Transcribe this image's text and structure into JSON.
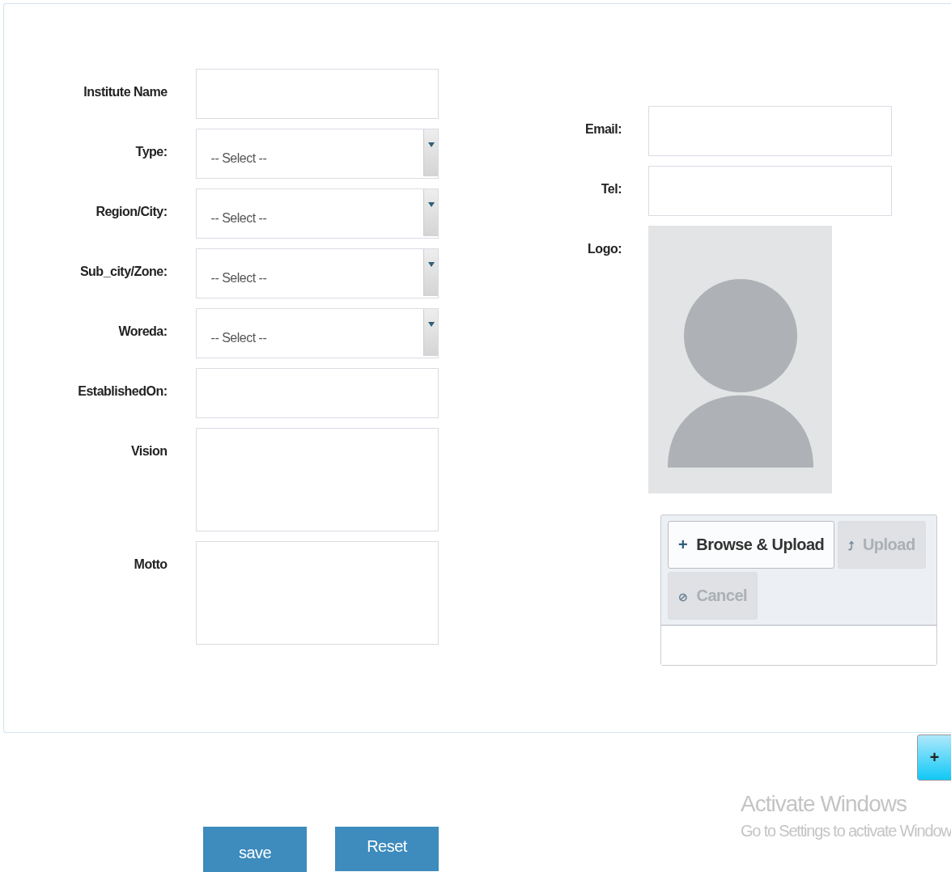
{
  "left_fields": [
    {
      "label": "Institute Name",
      "kind": "text"
    },
    {
      "label": "Type:",
      "kind": "select",
      "value": "-- Select --"
    },
    {
      "label": "Region/City:",
      "kind": "select",
      "value": "-- Select --"
    },
    {
      "label": "Sub_city/Zone:",
      "kind": "select",
      "value": "-- Select --"
    },
    {
      "label": "Woreda:",
      "kind": "select",
      "value": "-- Select --"
    },
    {
      "label": "EstablishedOn:",
      "kind": "text"
    },
    {
      "label": "Vision",
      "kind": "textarea"
    },
    {
      "label": "Motto",
      "kind": "textarea"
    }
  ],
  "right_fields": [
    {
      "label": "Email:",
      "kind": "text"
    },
    {
      "label": "Tel:",
      "kind": "text"
    }
  ],
  "logo": {
    "label": "Logo:"
  },
  "uploader": {
    "buttons": [
      {
        "label": "Browse & Upload",
        "icon": "+",
        "disabled": false
      },
      {
        "label": "Upload",
        "icon": "⤴",
        "disabled": true
      },
      {
        "label": "Cancel",
        "icon": "⊘",
        "disabled": true
      }
    ]
  },
  "add_button": {
    "label": "+"
  },
  "actions": [
    {
      "label": "save"
    },
    {
      "label": "Reset"
    }
  ],
  "os_notice": {
    "title": "Activate Windows",
    "text": "Go to Settings to activate Window"
  }
}
